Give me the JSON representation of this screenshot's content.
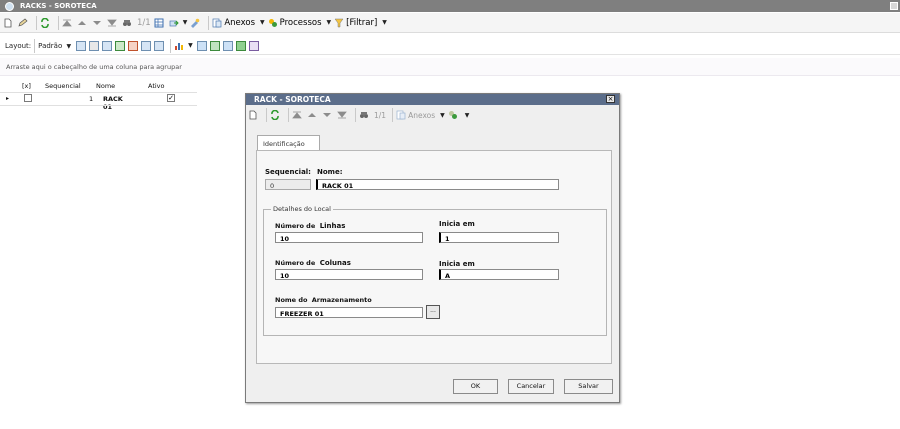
{
  "window": {
    "title": "RACKS - SOROTECA"
  },
  "toolbar": {
    "pager": "1/1",
    "anexos": "Anexos",
    "processos": "Processos",
    "filtrar": "[Filtrar]"
  },
  "layoutbar": {
    "layout_label": "Layout:",
    "layout_value": "Padrão"
  },
  "group_hint": "Arraste aqui o cabeçalho de uma coluna para agrupar",
  "grid": {
    "columns": [
      "[x]",
      "Sequencial",
      "Nome",
      "Ativo"
    ],
    "rows": [
      {
        "sequencial": "1",
        "nome": "RACK 01",
        "ativo": true
      }
    ]
  },
  "dialog": {
    "title": "RACK - SOROTECA",
    "pager": "1/1",
    "anexos": "Anexos",
    "tab": "Identificação",
    "sequencial_label": "Sequencial:",
    "sequencial_value": "0",
    "nome_label": "Nome:",
    "nome_value": "RACK 01",
    "group_label": "Detalhes do Local",
    "linhas_label_a": "Número de",
    "linhas_label_b": "Linhas",
    "linhas_value": "10",
    "inicia_linhas_label": "Inicia em",
    "inicia_linhas_value": "1",
    "colunas_label_a": "Número de",
    "colunas_label_b": "Colunas",
    "colunas_value": "10",
    "inicia_colunas_label": "Inicia em",
    "inicia_colunas_value": "A",
    "armazenamento_label_a": "Nome do",
    "armazenamento_label_b": "Armazenamento",
    "armazenamento_value": "FREEZER 01",
    "browse": "...",
    "ok": "OK",
    "cancelar": "Cancelar",
    "salvar": "Salvar"
  },
  "colors": {
    "title_bar": "#7f7f7f",
    "dialog_title": "#5b6d8a"
  }
}
